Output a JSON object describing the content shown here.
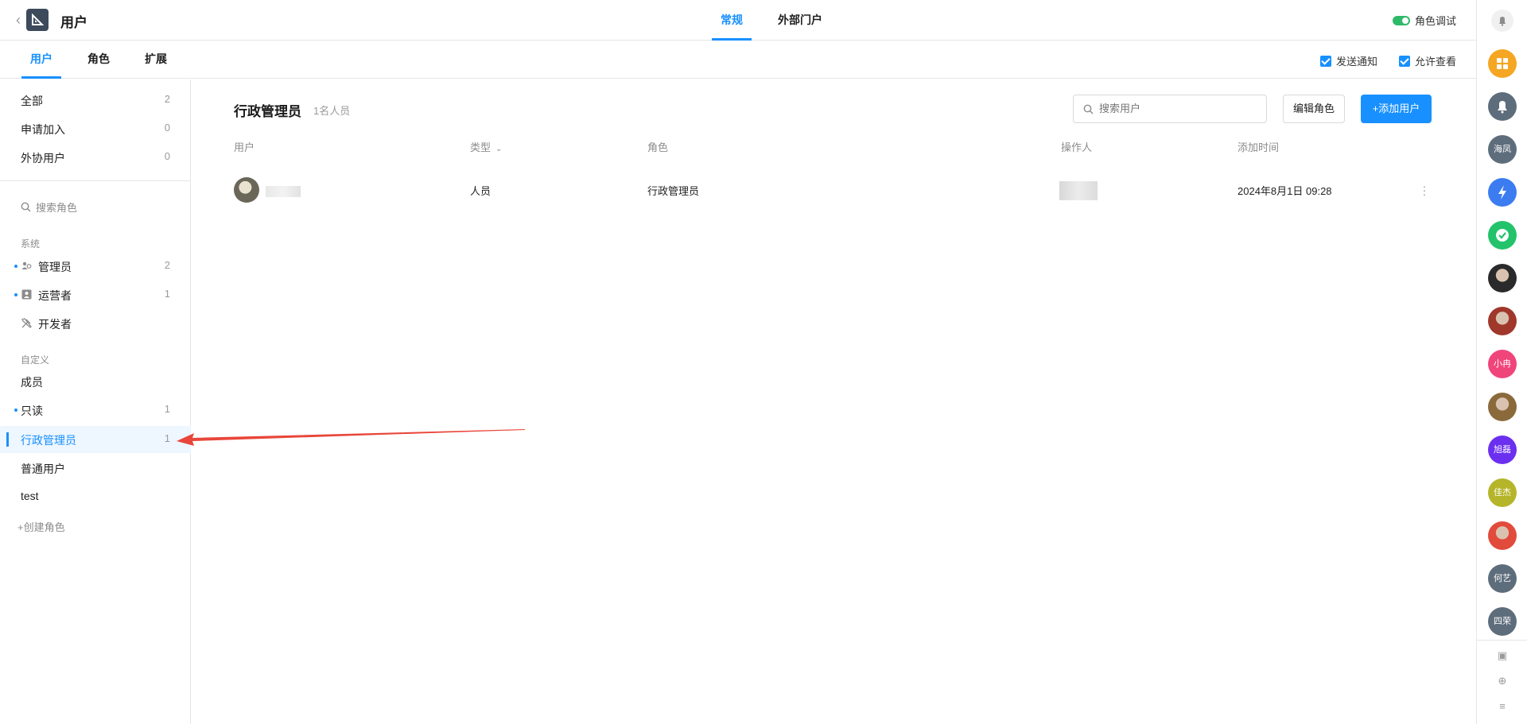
{
  "header": {
    "back_icon": "chevron-left-icon",
    "app_title": "用户",
    "tabs": [
      {
        "label": "常规",
        "active": true
      },
      {
        "label": "外部门户",
        "active": false
      }
    ],
    "role_debug_label": "角色调试",
    "role_debug_on": true
  },
  "subnav": {
    "tabs": [
      {
        "label": "用户",
        "active": true
      },
      {
        "label": "角色",
        "active": false
      },
      {
        "label": "扩展",
        "active": false
      }
    ],
    "send_notify_label": "发送通知",
    "send_notify_checked": true,
    "allow_view_label": "允许查看",
    "allow_view_checked": true
  },
  "sidebar": {
    "filters": [
      {
        "label": "全部",
        "count": "2"
      },
      {
        "label": "申请加入",
        "count": "0"
      },
      {
        "label": "外协用户",
        "count": "0"
      }
    ],
    "search_placeholder": "搜索角色",
    "system_group_label": "系统",
    "system_roles": [
      {
        "label": "管理员",
        "count": "2",
        "icon": "users-icon",
        "dot": true
      },
      {
        "label": "运营者",
        "count": "1",
        "icon": "id-card-icon",
        "dot": true
      },
      {
        "label": "开发者",
        "count": "",
        "icon": "tools-icon",
        "dot": false
      }
    ],
    "custom_group_label": "自定义",
    "custom_roles": [
      {
        "label": "成员",
        "count": "",
        "dot": false,
        "active": false
      },
      {
        "label": "只读",
        "count": "1",
        "dot": true,
        "active": false
      },
      {
        "label": "行政管理员",
        "count": "1",
        "dot": false,
        "active": true
      },
      {
        "label": "普通用户",
        "count": "",
        "dot": false,
        "active": false
      },
      {
        "label": "test",
        "count": "",
        "dot": false,
        "active": false
      }
    ],
    "create_role_label": "+创建角色"
  },
  "main": {
    "title": "行政管理员",
    "member_count": "1名人员",
    "search_placeholder": "搜索用户",
    "edit_role_label": "编辑角色",
    "add_user_label": "+添加用户",
    "columns": [
      "用户",
      "类型",
      "角色",
      "操作人",
      "添加时间"
    ],
    "rows": [
      {
        "type": "人员",
        "role": "行政管理员",
        "added_time": "2024年8月1日 09:28"
      }
    ]
  },
  "rail": {
    "items": [
      {
        "name": "apps-icon",
        "text": "",
        "color": "#f5a623"
      },
      {
        "name": "bell-icon",
        "text": "",
        "color": "#5e6d7c"
      },
      {
        "name": "avatar-haifeng",
        "text": "海凤",
        "color": "#5e6d7c"
      },
      {
        "name": "lightning-app-icon",
        "text": "",
        "color": "#3b7cf0"
      },
      {
        "name": "check-app-icon",
        "text": "",
        "color": "#23c36b"
      },
      {
        "name": "avatar-photo-1",
        "text": "",
        "color": "#2a2a2a"
      },
      {
        "name": "avatar-photo-2",
        "text": "",
        "color": "#a0372b"
      },
      {
        "name": "avatar-xiaoran",
        "text": "小冉",
        "color": "#f0457a"
      },
      {
        "name": "avatar-photo-3",
        "text": "",
        "color": "#8a6a3b"
      },
      {
        "name": "avatar-xulei",
        "text": "旭磊",
        "color": "#6b2ff0"
      },
      {
        "name": "avatar-jiajie",
        "text": "佳杰",
        "color": "#b5b52a"
      },
      {
        "name": "avatar-photo-4",
        "text": "",
        "color": "#e24a3b"
      },
      {
        "name": "avatar-heyi",
        "text": "何艺",
        "color": "#5e6d7c"
      },
      {
        "name": "avatar-sirong",
        "text": "四荣",
        "color": "#5e6d7c"
      }
    ]
  },
  "colors": {
    "accent": "#1890ff",
    "annotation_arrow": "#e8463a"
  }
}
